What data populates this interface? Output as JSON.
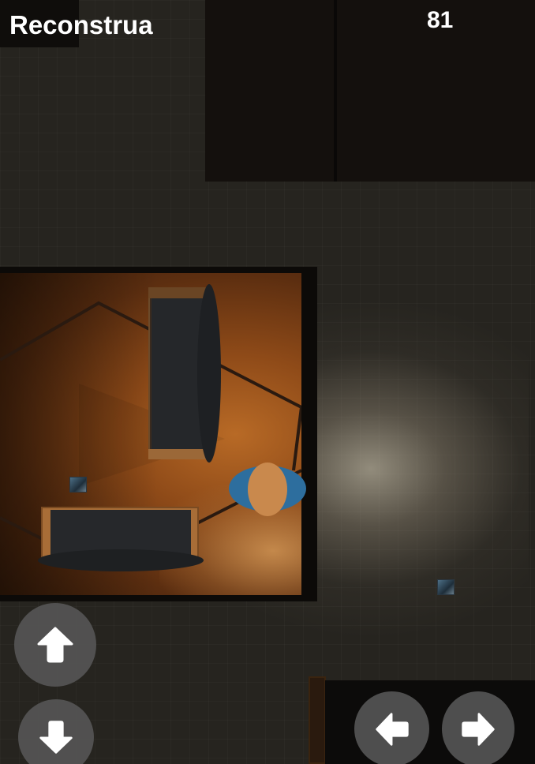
{
  "hud": {
    "title": "Reconstrua",
    "score": "81"
  },
  "controls": {
    "up": {
      "icon": "arrow-up-icon"
    },
    "down": {
      "icon": "arrow-down-icon"
    },
    "left": {
      "icon": "arrow-left-icon"
    },
    "right": {
      "icon": "arrow-right-icon"
    }
  },
  "colors": {
    "control_bg": "#555555",
    "control_icon": "#ffffff",
    "player_shirt": "#2d6e9e",
    "player_head": "#c9894d",
    "room_floor": "#8e4a18"
  }
}
